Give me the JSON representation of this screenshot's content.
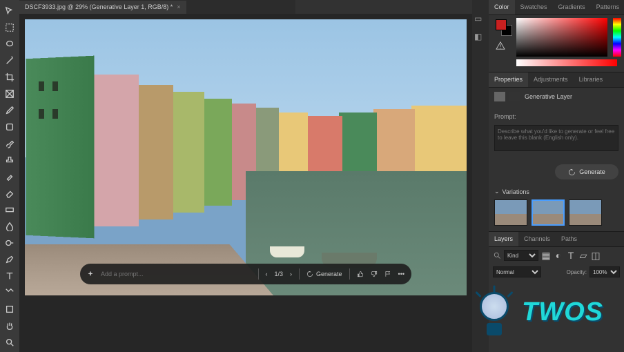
{
  "document": {
    "tab_label": "DSCF3933.jpg @ 29% (Generative Layer 1, RGB/8) *"
  },
  "prompt_bar": {
    "placeholder": "Add a prompt...",
    "pager": "1/3",
    "generate_label": "Generate"
  },
  "color_tabs": [
    "Color",
    "Swatches",
    "Gradients",
    "Patterns"
  ],
  "color_tabs_active": "Color",
  "foreground_color": "#c82020",
  "background_color": "#000000",
  "props_tabs": [
    "Properties",
    "Adjustments",
    "Libraries"
  ],
  "props_tabs_active": "Properties",
  "layer_name": "Generative Layer",
  "prompt_label": "Prompt:",
  "prompt_placeholder": "Describe what you'd like to generate or feel free to leave this blank (English only).",
  "generate_btn": "Generate",
  "variations_label": "Variations",
  "layers_tabs": [
    "Layers",
    "Channels",
    "Paths"
  ],
  "layers_tabs_active": "Layers",
  "layer_filter": "Kind",
  "blend_mode": "Normal",
  "opacity_label": "Opacity:",
  "opacity_value": "100%",
  "watermark_text": "TWOS"
}
